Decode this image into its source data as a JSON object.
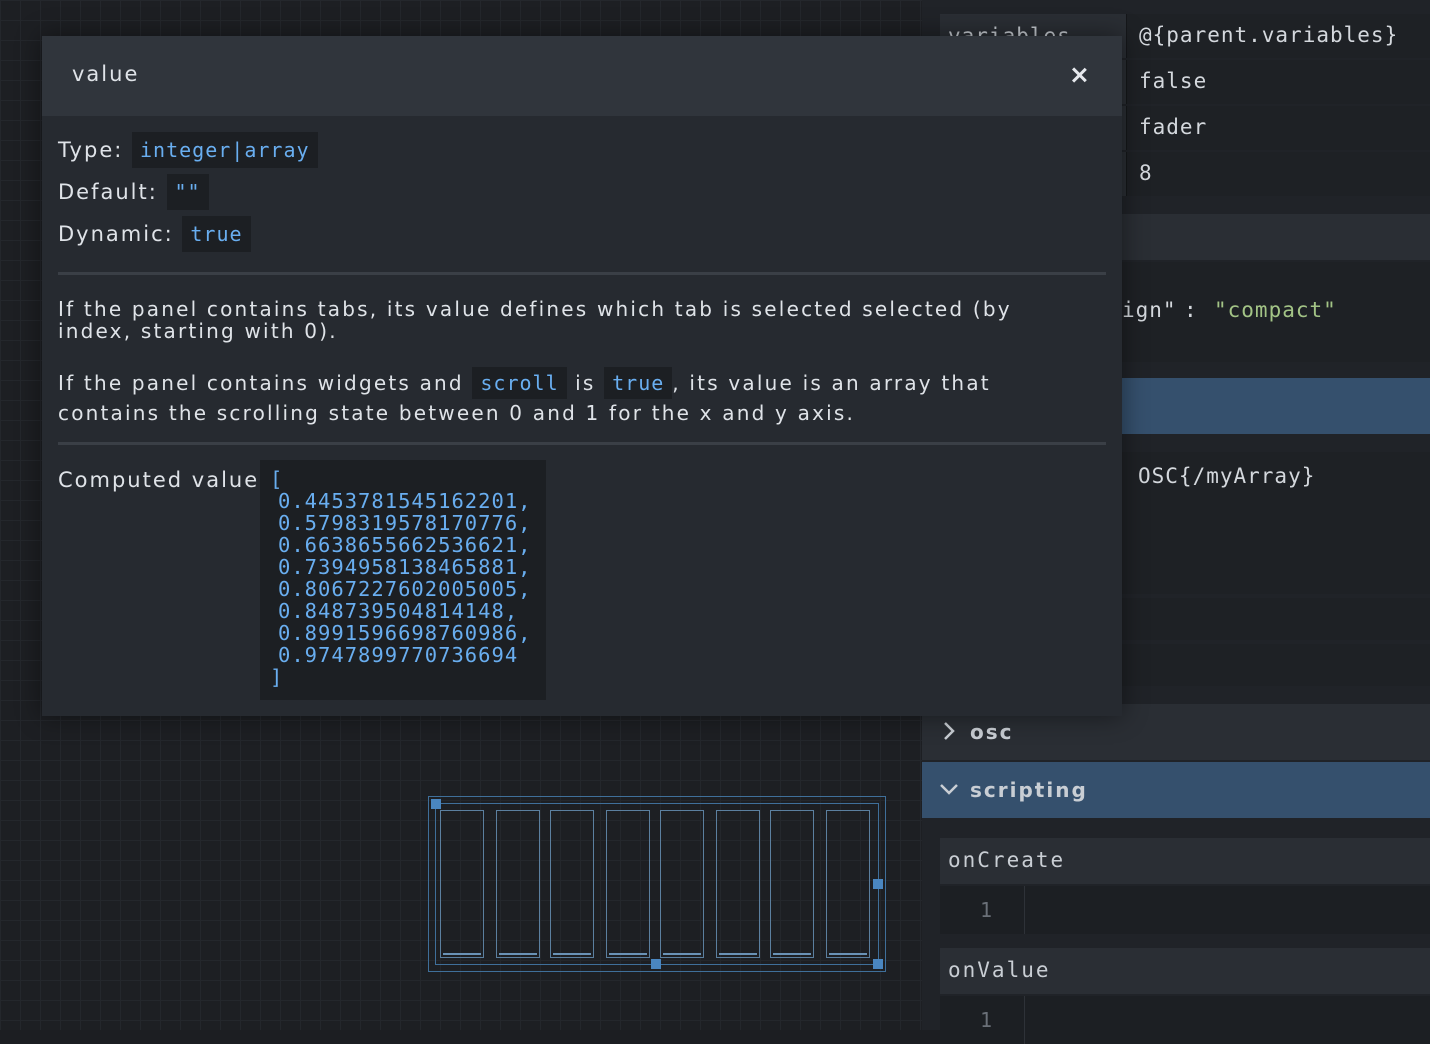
{
  "modal": {
    "title": "value",
    "close_icon": "close-icon",
    "type_label": "Type:",
    "type_value": "integer|array",
    "default_label": "Default:",
    "default_value": "\"\"",
    "dynamic_label": "Dynamic:",
    "dynamic_value": "true",
    "description_1": "If the panel contains tabs, its value defines which tab is selected selected (by index, starting with 0).",
    "description_2": {
      "part1": "If the panel contains widgets and",
      "code1": "scroll",
      "part2": "is",
      "code2": "true",
      "part3": ", its value is an array that contains the scrolling state between 0 and 1 for the x and y axis."
    },
    "computed_label": "Computed value:",
    "computed_open": "[",
    "computed_values": [
      "0.4453781545162201,",
      "0.5798319578170776,",
      "0.6638655662536621,",
      "0.7394958138465881,",
      "0.8067227602005005,",
      "0.848739504814148,",
      "0.8991596698760986,",
      "0.9747899770736694"
    ],
    "computed_close": "]"
  },
  "inspector": {
    "rows": [
      {
        "key": "variables",
        "value": "@{parent.variables}"
      },
      {
        "key": "",
        "value": "false"
      },
      {
        "key": "",
        "value": "fader"
      },
      {
        "key": "",
        "value": "8"
      }
    ],
    "css_fragment": {
      "key": "ign\"",
      "colon": ":",
      "value": "\"compact\""
    },
    "address_value": "OSC{/myArray}",
    "sections": [
      {
        "label": "osc",
        "icon": "chevron-right-icon",
        "expanded": false
      },
      {
        "label": "scripting",
        "icon": "chevron-down-icon",
        "expanded": true
      }
    ],
    "scripts": [
      {
        "label": "onCreate",
        "line": "1"
      },
      {
        "label": "onValue",
        "line": "1"
      }
    ]
  },
  "colors": {
    "accent": "#69aef0",
    "section_active": "#35506d",
    "widget_border": "#3f6f9a",
    "string_green": "#a3c486"
  }
}
